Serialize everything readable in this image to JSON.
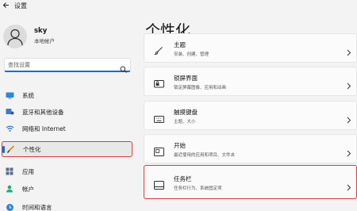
{
  "window": {
    "title": "设置"
  },
  "user": {
    "name": "sky",
    "account_type": "本地帐户"
  },
  "search": {
    "placeholder": "查找设置"
  },
  "sidebar": {
    "items": [
      {
        "label": "系统"
      },
      {
        "label": "蓝牙和其他设备"
      },
      {
        "label": "网络和 Internet"
      },
      {
        "label": "个性化"
      },
      {
        "label": "应用"
      },
      {
        "label": "帐户"
      },
      {
        "label": "时间和语言"
      }
    ]
  },
  "main": {
    "title": "个性化",
    "cards": [
      {
        "title": "主题",
        "subtitle": "安装、创建、管理"
      },
      {
        "title": "锁屏界面",
        "subtitle": "锁定屏幕图像、应用和动画"
      },
      {
        "title": "触摸键盘",
        "subtitle": "主题、大小"
      },
      {
        "title": "开始",
        "subtitle": "最近使用的应用和项目、文件夹"
      },
      {
        "title": "任务栏",
        "subtitle": "任务栏行为、系统固定项"
      }
    ]
  },
  "colors": {
    "accent": "#0a6fd1",
    "highlight": "#e0383b"
  }
}
